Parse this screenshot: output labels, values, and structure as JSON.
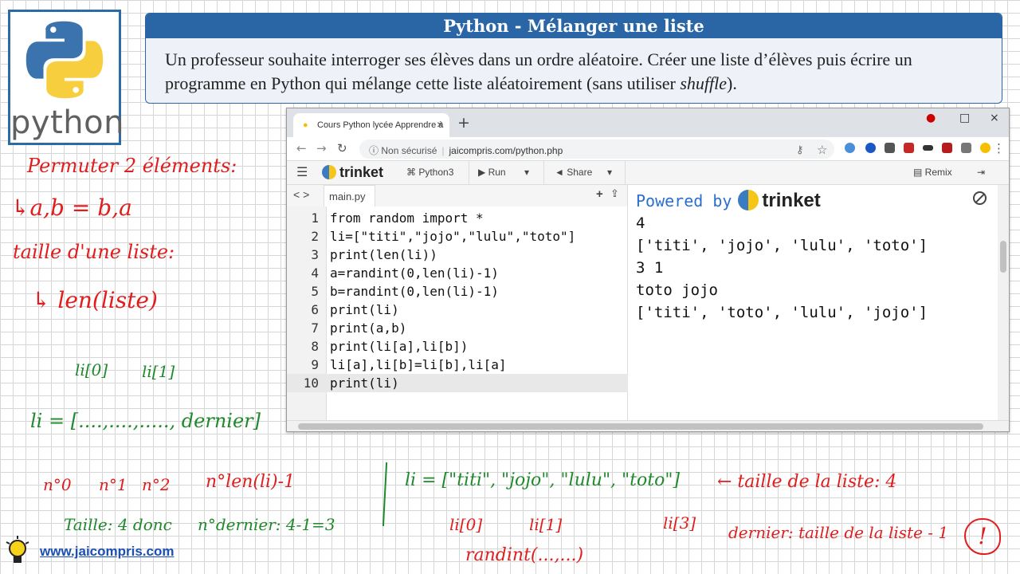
{
  "exercise": {
    "title": "Python - Mélanger une liste",
    "body_prefix": "Un professeur souhaite interroger ses élèves dans un ordre aléatoire. Créer une liste d’élèves puis écrire un programme en Python qui mélange cette liste aléatoirement (sans utiliser ",
    "body_emph": "shuffle",
    "body_suffix": ")."
  },
  "logo": {
    "word": "python"
  },
  "browser": {
    "tab_title": "Cours Python lycée Apprendre à",
    "not_secure": "Non sécurisé",
    "url": "jaicompris.com/python.php"
  },
  "trinket_toolbar": {
    "brand": "trinket",
    "language": "Python3",
    "run": "Run",
    "share": "Share",
    "remix": "Remix"
  },
  "editor": {
    "filename": "main.py",
    "lines": [
      {
        "n": "1",
        "code": "from random import *"
      },
      {
        "n": "2",
        "code": "li=[\"titi\",\"jojo\",\"lulu\",\"toto\"]"
      },
      {
        "n": "3",
        "code": "print(len(li))"
      },
      {
        "n": "4",
        "code": "a=randint(0,len(li)-1)"
      },
      {
        "n": "5",
        "code": "b=randint(0,len(li)-1)"
      },
      {
        "n": "6",
        "code": "print(li)"
      },
      {
        "n": "7",
        "code": "print(a,b)"
      },
      {
        "n": "8",
        "code": "print(li[a],li[b])"
      },
      {
        "n": "9",
        "code": "li[a],li[b]=li[b],li[a]"
      },
      {
        "n": "10",
        "code": "print(li)"
      }
    ]
  },
  "output": {
    "powered_by": "Powered by",
    "brand": "trinket",
    "lines": [
      "4",
      "['titi', 'jojo', 'lulu', 'toto']",
      "3 1",
      "toto jojo",
      "['titi', 'toto', 'lulu', 'jojo']"
    ]
  },
  "notes": {
    "permuter": "Permuter 2 éléments:",
    "swap": "↳a,b = b,a",
    "taille": "taille d'une liste:",
    "len": "↳ len(liste)",
    "li0": "li[0]",
    "li1": "li[1]",
    "li_list": "li = [....,....,....., dernier]",
    "n0": "n°0",
    "n1": "n°1",
    "n2": "n°2",
    "nlen": "n°len(li)-1",
    "taille_donc": "Taille: 4 donc",
    "ndernier": "n°dernier: 4-1=3",
    "li_example": "li = [\"titi\", \"jojo\", \"lulu\", \"toto\"]",
    "taille_liste": "← taille de la liste: 4",
    "ex_li0": "li[0]",
    "ex_li1": "li[1]",
    "ex_li3": "li[3]",
    "dernier_eq": "dernier: taille de la liste - 1",
    "warn": "!",
    "randint": "randint(...,...)"
  },
  "footer": {
    "site": "www.jaicompris.com"
  },
  "colors": {
    "accent": "#2a65a5",
    "annot_red": "#e11d1d",
    "annot_green": "#1f8a2b"
  }
}
